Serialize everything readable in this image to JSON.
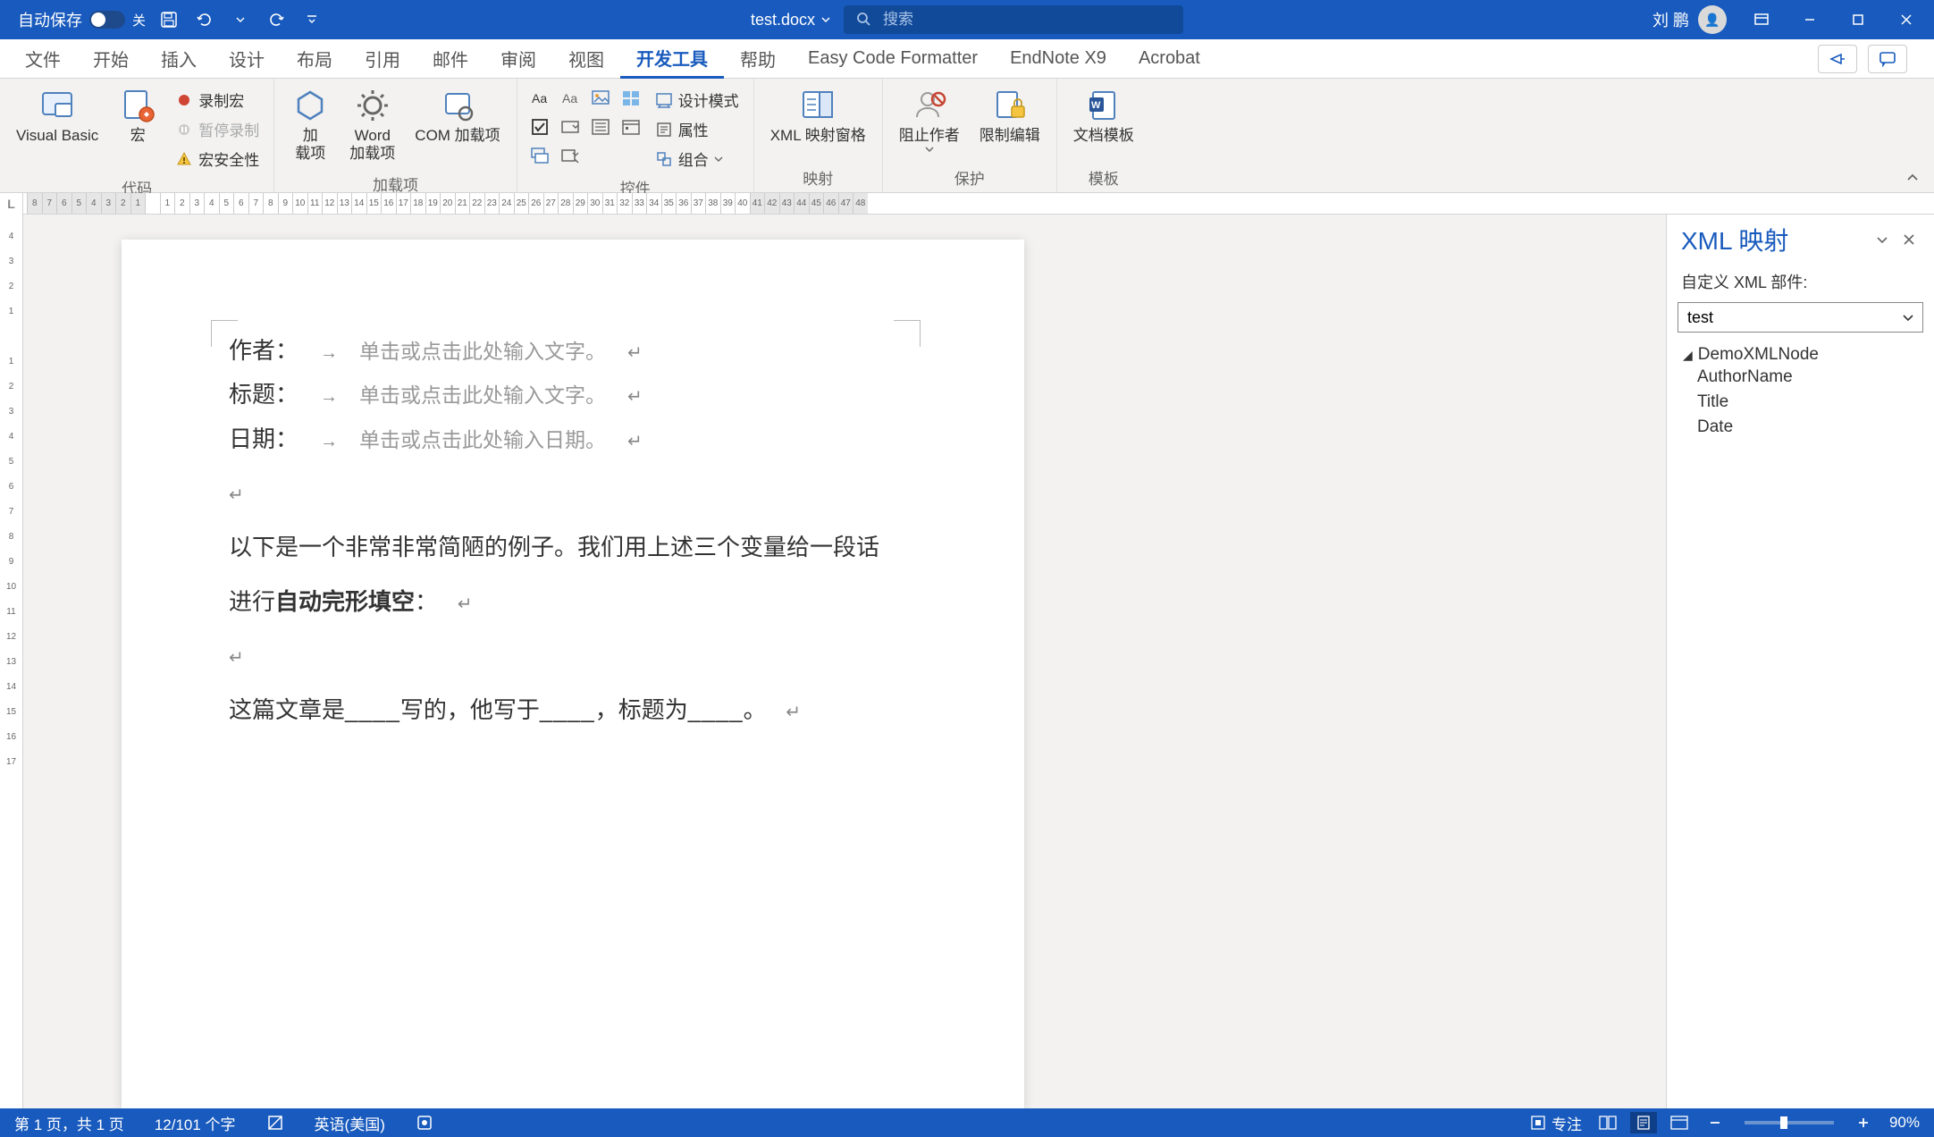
{
  "title_bar": {
    "autosave_label": "自动保存",
    "autosave_state": "关",
    "doc_name": "test.docx",
    "search_placeholder": "搜索",
    "user_name": "刘 鹏"
  },
  "tabs": {
    "file": "文件",
    "home": "开始",
    "insert": "插入",
    "design": "设计",
    "layout": "布局",
    "references": "引用",
    "mailings": "邮件",
    "review": "审阅",
    "view": "视图",
    "developer": "开发工具",
    "help": "帮助",
    "ecf": "Easy Code Formatter",
    "endnote": "EndNote X9",
    "acrobat": "Acrobat"
  },
  "ribbon": {
    "code": {
      "vb": "Visual Basic",
      "macros": "宏",
      "record": "录制宏",
      "pause": "暂停录制",
      "security": "宏安全性",
      "group": "代码"
    },
    "addins": {
      "addin": "加\n载项",
      "word_addin": "Word\n加载项",
      "com_addin": "COM 加载项",
      "group": "加载项"
    },
    "controls": {
      "design_mode": "设计模式",
      "properties": "属性",
      "group_ctl": "组合",
      "group": "控件"
    },
    "mapping": {
      "xml_pane": "XML 映射窗格",
      "group": "映射"
    },
    "protect": {
      "block": "阻止作者",
      "restrict": "限制编辑",
      "group": "保护"
    },
    "template": {
      "doc_template": "文档模板",
      "group": "模板"
    }
  },
  "document": {
    "author_label": "作者：",
    "title_label": "标题：",
    "date_label": "日期：",
    "text_placeholder": "单击或点击此处输入文字。",
    "date_placeholder": "单击或点击此处输入日期。",
    "para1": "以下是一个非常非常简陋的例子。我们用上述三个变量给一段话",
    "para2_pre": "进行",
    "para2_bold": "自动完形填空",
    "para2_post": "：",
    "para3_1": "这篇文章是",
    "para3_2": "写的，他写于",
    "para3_3": "，标题为",
    "para3_4": "。",
    "blank": "____"
  },
  "xml_pane": {
    "title": "XML 映射",
    "subtitle": "自定义 XML 部件:",
    "selected": "test",
    "root": "DemoXMLNode",
    "nodes": [
      "AuthorName",
      "Title",
      "Date"
    ]
  },
  "status": {
    "page": "第 1 页，共 1 页",
    "words": "12/101 个字",
    "lang": "英语(美国)",
    "focus": "专注",
    "zoom": "90%"
  },
  "ruler_h": [
    "8",
    "7",
    "6",
    "5",
    "4",
    "3",
    "2",
    "1",
    "",
    "1",
    "2",
    "3",
    "4",
    "5",
    "6",
    "7",
    "8",
    "9",
    "10",
    "11",
    "12",
    "13",
    "14",
    "15",
    "16",
    "17",
    "18",
    "19",
    "20",
    "21",
    "22",
    "23",
    "24",
    "25",
    "26",
    "27",
    "28",
    "29",
    "30",
    "31",
    "32",
    "33",
    "34",
    "35",
    "36",
    "37",
    "38",
    "39",
    "40",
    "41",
    "42",
    "43",
    "44",
    "45",
    "46",
    "47",
    "48"
  ],
  "ruler_v": [
    "4",
    "3",
    "2",
    "1",
    "",
    "1",
    "2",
    "3",
    "4",
    "5",
    "6",
    "7",
    "8",
    "9",
    "10",
    "11",
    "12",
    "13",
    "14",
    "15",
    "16",
    "17"
  ]
}
